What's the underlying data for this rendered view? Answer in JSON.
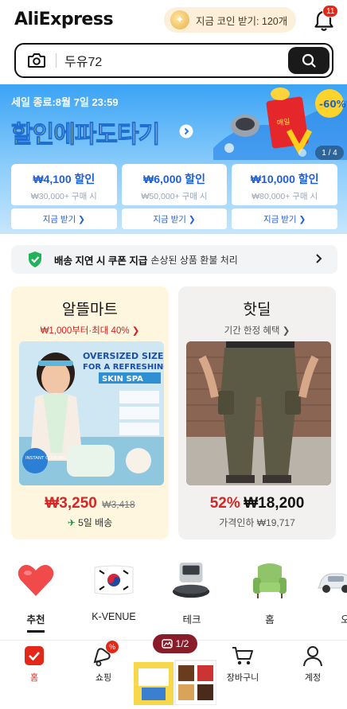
{
  "header": {
    "logo_text": "AliExpress",
    "coin_text": "지금 코인 받기: 120개",
    "notification_count": "11"
  },
  "search": {
    "query": "두유72"
  },
  "banner": {
    "sale_text": "세일 종료:8월 7일 23:59",
    "title_part1": "할인에",
    "title_part2": "파도타기",
    "counter": "1 / 4",
    "badge_discount": "-60%",
    "coupons": [
      {
        "amount": "₩4,100 할인",
        "condition": "₩30,000+ 구매 시",
        "button": "지금 받기 ❯"
      },
      {
        "amount": "₩6,000 할인",
        "condition": "₩50,000+ 구매 시",
        "button": "지금 받기 ❯"
      },
      {
        "amount": "₩10,000 할인",
        "condition": "₩80,000+ 구매 시",
        "button": "지금 받기 ❯"
      }
    ]
  },
  "notice": {
    "bold": "배송 지연 시 쿠폰 지급",
    "sub": "손상된 상품 환불 처리"
  },
  "cards": {
    "left": {
      "title": "알뜰마트",
      "subtitle": "₩1,000부터·최대 40%  ❯",
      "price": "₩3,250",
      "original_price": "₩3,418",
      "shipping": "5일 배송",
      "img_text1": "OVERSIZED SIZE",
      "img_text2": "FOR A REFRESHING",
      "img_text3": "SKIN SPA",
      "img_badge": "INSTANT COOLING"
    },
    "right": {
      "title": "핫딜",
      "subtitle": "기간 한정 혜택  ❯",
      "discount": "52%",
      "price": "₩18,200",
      "foot": "가격인하 ₩19,717"
    }
  },
  "categories": [
    {
      "label": "추천",
      "icon": "heart-icon"
    },
    {
      "label": "K-VENUE",
      "icon": "korea-flag-icon"
    },
    {
      "label": "테크",
      "icon": "robot-vacuum-icon"
    },
    {
      "label": "홈",
      "icon": "armchair-icon"
    },
    {
      "label": "오",
      "icon": "car-icon"
    }
  ],
  "pager": {
    "text": "1/2"
  },
  "tabbar": {
    "items": [
      {
        "label": "홈",
        "icon": "home-icon"
      },
      {
        "label": "쇼핑",
        "icon": "shopping-icon"
      },
      {
        "label": "장바구니",
        "icon": "cart-icon"
      },
      {
        "label": "계정",
        "icon": "account-icon"
      }
    ],
    "shopping_badge": "%"
  },
  "colors": {
    "accent_red": "#e3281a",
    "coupon_blue": "#1d5fd6",
    "banner_blue": "#3aa3f5"
  }
}
